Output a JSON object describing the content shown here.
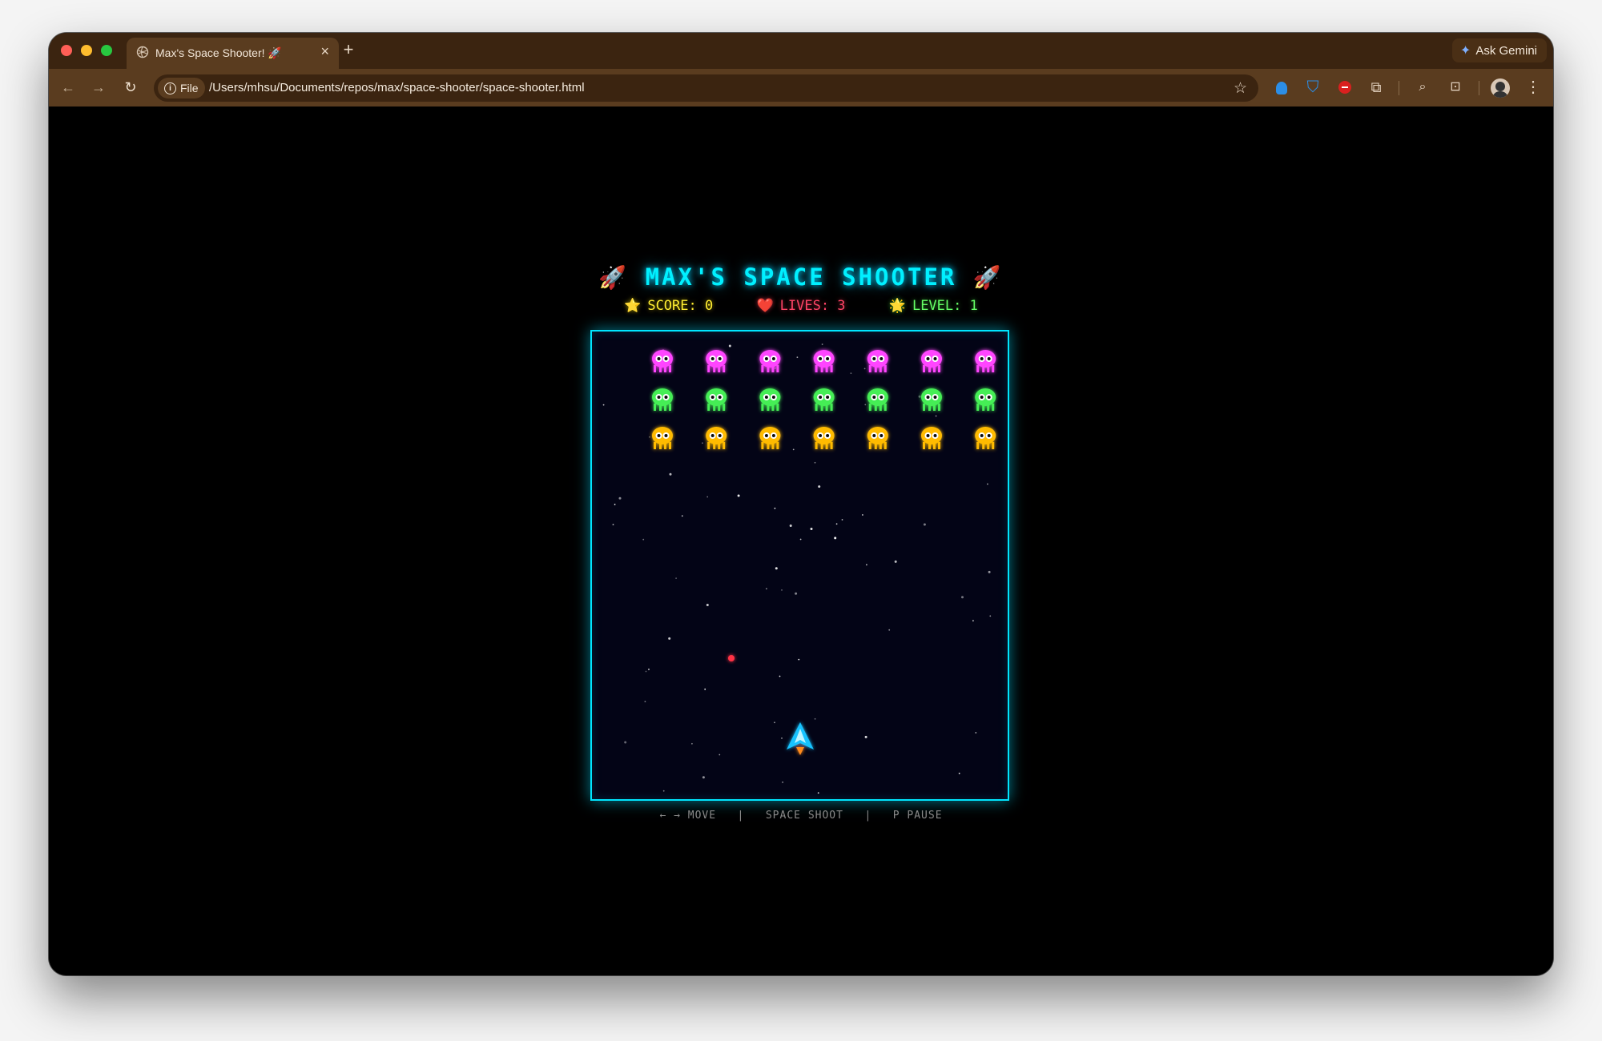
{
  "browser": {
    "tab_title": "Max's Space Shooter! 🚀",
    "tab_close": "×",
    "new_tab": "+",
    "ask_gemini": "Ask Gemini",
    "file_chip": "File",
    "url": "/Users/mhsu/Documents/repos/max/space-shooter/space-shooter.html"
  },
  "game": {
    "title": "MAX'S SPACE SHOOTER",
    "rocket": "🚀",
    "hud": {
      "score_icon": "⭐",
      "score": "SCORE: 0",
      "lives_icon": "❤️",
      "lives": "LIVES: 3",
      "level_icon": "🌟",
      "level": "LEVEL: 1"
    },
    "aliens": {
      "rows": [
        {
          "color": "#ff44ff",
          "count": 7
        },
        {
          "color": "#44ee55",
          "count": 7
        },
        {
          "color": "#ffbb00",
          "count": 7
        }
      ]
    },
    "bullet_color": "#ff3344",
    "ship_color": "#19c3ff",
    "controls": {
      "move": "← → MOVE",
      "shoot": "SPACE SHOOT",
      "pause": "P PAUSE",
      "sep": "|"
    }
  }
}
